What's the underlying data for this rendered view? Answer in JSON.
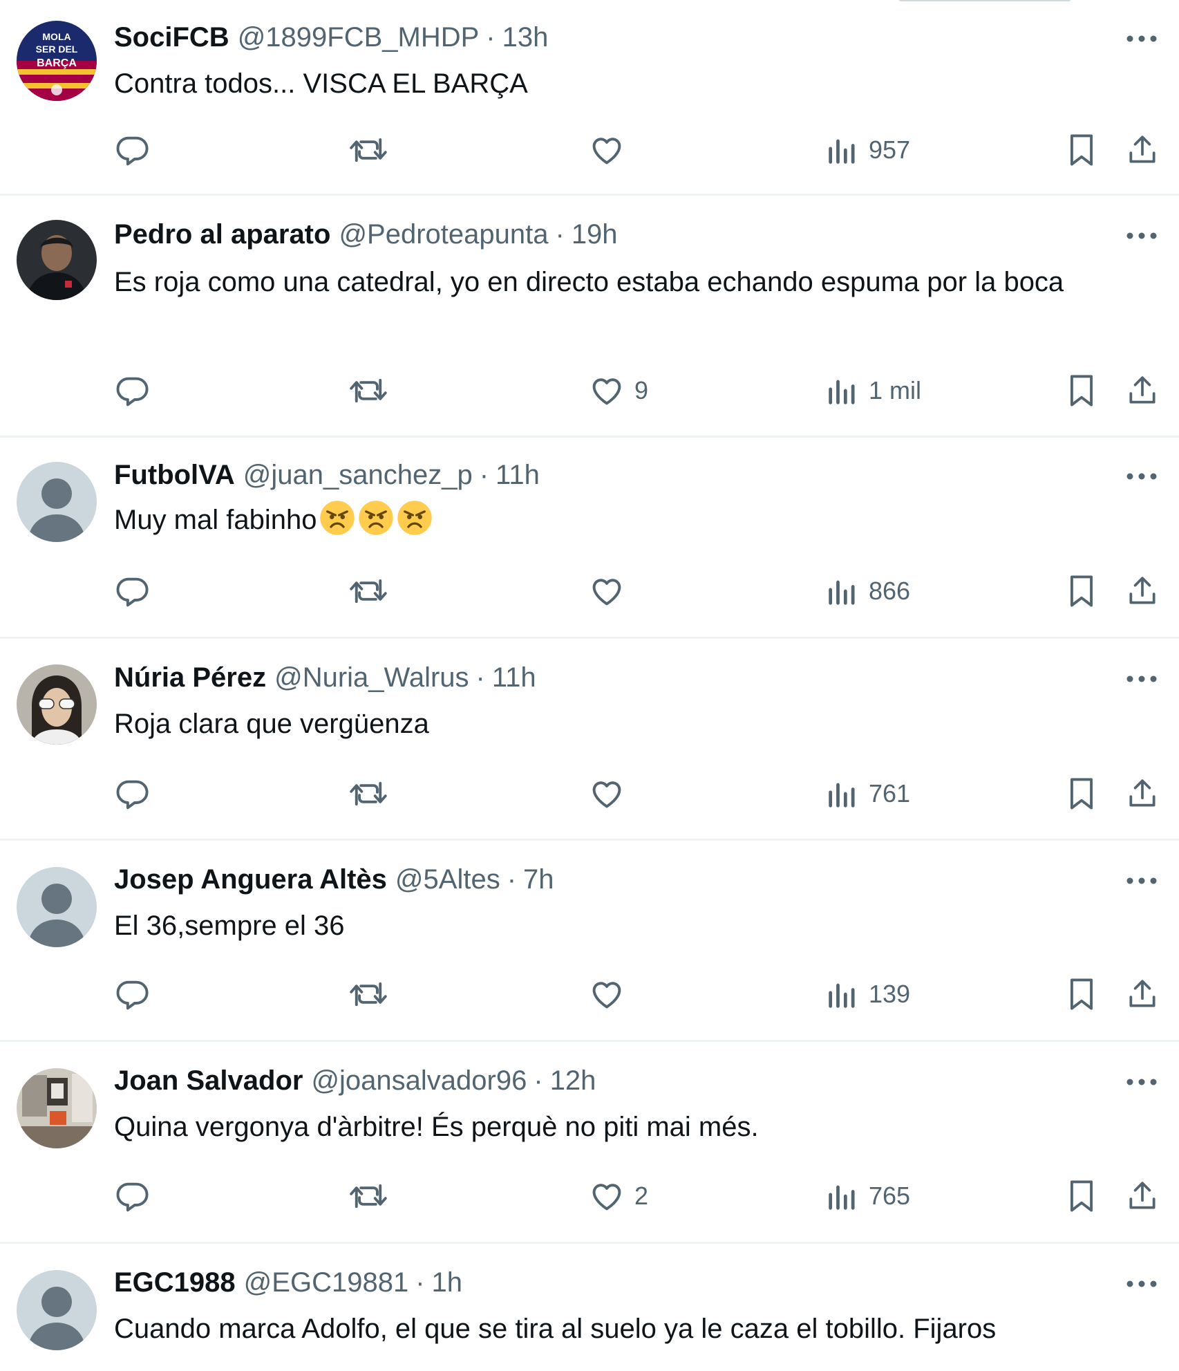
{
  "colors": {
    "text_primary": "#0f1419",
    "text_secondary": "#536471",
    "divider": "#eff3f4",
    "default_avatar_bg": "#ccd6dd",
    "default_avatar_fg": "#8899a6"
  },
  "icons": {
    "reply": "reply-icon",
    "repost": "repost-icon",
    "like": "heart-icon",
    "views": "views-chart-icon",
    "bookmark": "bookmark-icon",
    "share": "share-icon",
    "more": "more-dots-icon"
  },
  "tweets": [
    {
      "name": "SociFCB",
      "handle": "@1899FCB_MHDP",
      "separator": "·",
      "time": "13h",
      "text": "Contra todos... VISCA EL BARÇA",
      "likes": "",
      "views": "957",
      "avatar_type": "logo",
      "avatar_text": [
        "MOLA",
        "SER DEL",
        "BARÇA"
      ]
    },
    {
      "name": "Pedro al aparato",
      "handle": "@Pedroteapunta",
      "separator": "·",
      "time": "19h",
      "text": "Es roja como una catedral, yo en directo estaba echando espuma por la boca",
      "likes": "9",
      "views": "1 mil",
      "avatar_type": "photo-dark"
    },
    {
      "name": "FutbolVA",
      "handle": "@juan_sanchez_p",
      "separator": "·",
      "time": "11h",
      "text": "Muy mal fabinho",
      "emoji_count": 3,
      "likes": "",
      "views": "866",
      "avatar_type": "default"
    },
    {
      "name": "Núria Pérez",
      "handle": "@Nuria_Walrus",
      "separator": "·",
      "time": "11h",
      "text": "Roja clara que vergüenza",
      "likes": "",
      "views": "761",
      "avatar_type": "photo-sunglasses"
    },
    {
      "name": "Josep Anguera Altès",
      "handle": "@5Altes",
      "separator": "·",
      "time": "7h",
      "text": "El 36,sempre el 36",
      "likes": "",
      "views": "139",
      "avatar_type": "default"
    },
    {
      "name": "Joan Salvador",
      "handle": "@joansalvador96",
      "separator": "·",
      "time": "12h",
      "text": "Quina vergonya d'àrbitre! És perquè no piti mai més.",
      "likes": "2",
      "views": "765",
      "avatar_type": "photo-room"
    },
    {
      "name": "EGC1988",
      "handle": "@EGC19881",
      "separator": "·",
      "time": "1h",
      "text": "Cuando marca Adolfo, el que se tira al suelo ya le caza el tobillo. Fijaros",
      "likes": "",
      "views": "",
      "avatar_type": "default"
    }
  ]
}
